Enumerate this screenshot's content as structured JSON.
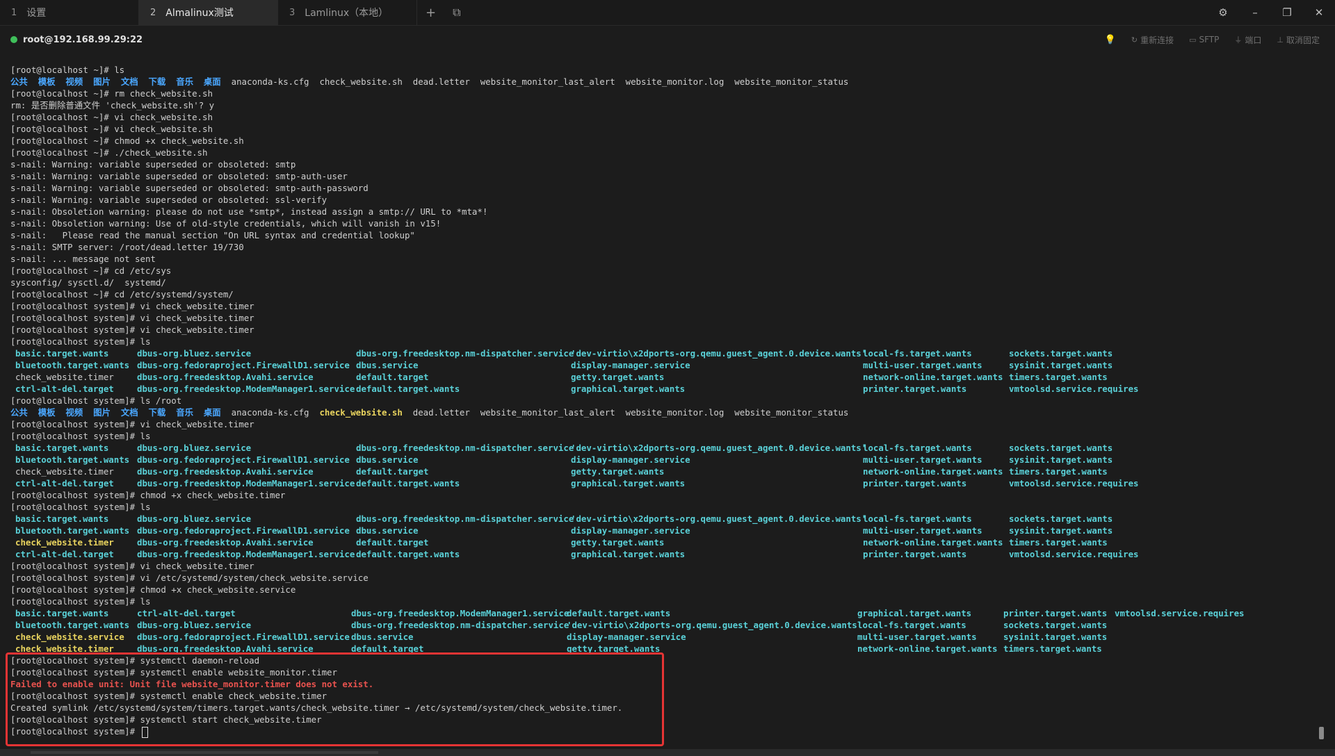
{
  "tabs": [
    {
      "num": "1",
      "label": "设置"
    },
    {
      "num": "2",
      "label": "Almalinux测试"
    },
    {
      "num": "3",
      "label": "Lamlinux（本地）"
    }
  ],
  "tab_controls": {
    "add": "+",
    "layout": "⧉"
  },
  "window_controls": {
    "settings": "⚙",
    "minimize": "–",
    "restore": "❐",
    "close": "✕"
  },
  "session": {
    "status_color": "#3fbf5a",
    "host": "root@192.168.99.29:22",
    "tools": {
      "bulb": "💡",
      "reconnect": "重新连接",
      "sftp": "SFTP",
      "port": "端口",
      "unpin": "取消固定"
    }
  },
  "colors": {
    "directory": "#4aa7ff",
    "link": "#5ad1d8",
    "executable": "#e8d35e",
    "error": "#e8524e",
    "highlight": "#e53434"
  },
  "terminal": {
    "b0": "[root@localhost ~]# ls",
    "ls_root": {
      "dirs": [
        "公共",
        "模板",
        "视频",
        "图片",
        "文档",
        "下载",
        "音乐",
        "桌面"
      ],
      "files": [
        "anaconda-ks.cfg",
        "check_website.sh",
        "dead.letter",
        "website_monitor_last_alert",
        "website_monitor.log",
        "website_monitor_status"
      ]
    },
    "b1": [
      "[root@localhost ~]# rm check_website.sh",
      "rm: 是否删除普通文件 'check_website.sh'? y",
      "[root@localhost ~]# vi check_website.sh",
      "[root@localhost ~]# vi check_website.sh",
      "[root@localhost ~]# chmod +x check_website.sh",
      "[root@localhost ~]# ./check_website.sh",
      "s-nail: Warning: variable superseded or obsoleted: smtp",
      "s-nail: Warning: variable superseded or obsoleted: smtp-auth-user",
      "s-nail: Warning: variable superseded or obsoleted: smtp-auth-password",
      "s-nail: Warning: variable superseded or obsoleted: ssl-verify",
      "s-nail: Obsoletion warning: please do not use *smtp*, instead assign a smtp:// URL to *mta*!",
      "s-nail: Obsoletion warning: Use of old-style credentials, which will vanish in v15!",
      "s-nail:   Please read the manual section \"On URL syntax and credential lookup\"",
      "s-nail: SMTP server: /root/dead.letter 19/730",
      "s-nail: ... message not sent",
      "[root@localhost ~]# cd /etc/sys",
      "sysconfig/ sysctl.d/  systemd/",
      "[root@localhost ~]# cd /etc/systemd/system/",
      "[root@localhost system]# vi check_website.timer",
      "[root@localhost system]# vi check_website.timer",
      "[root@localhost system]# vi check_website.timer",
      "[root@localhost system]# ls"
    ],
    "ls_sys_a": [
      [
        "basic.target.wants",
        "dbus-org.bluez.service",
        "dbus-org.freedesktop.nm-dispatcher.service",
        "'dev-virtio\\x2dports-org.qemu.guest_agent.0.device.wants'",
        "local-fs.target.wants",
        "sockets.target.wants"
      ],
      [
        "bluetooth.target.wants",
        "dbus-org.fedoraproject.FirewallD1.service",
        "dbus.service",
        "display-manager.service",
        "multi-user.target.wants",
        "sysinit.target.wants"
      ],
      [
        "check_website.timer",
        "dbus-org.freedesktop.Avahi.service",
        "default.target",
        "getty.target.wants",
        "network-online.target.wants",
        "timers.target.wants"
      ],
      [
        "ctrl-alt-del.target",
        "dbus-org.freedesktop.ModemManager1.service",
        "default.target.wants",
        "graphical.target.wants",
        "printer.target.wants",
        "vmtoolsd.service.requires"
      ]
    ],
    "b2": "[root@localhost system]# ls /root",
    "b3": [
      "[root@localhost system]# vi check_website.timer",
      "[root@localhost system]# ls"
    ],
    "b4": [
      "[root@localhost system]# chmod +x check_website.timer",
      "[root@localhost system]# ls"
    ],
    "b5": [
      "[root@localhost system]# vi check_website.timer",
      "[root@localhost system]# vi /etc/systemd/system/check_website.service",
      "[root@localhost system]# chmod +x check_website.service",
      "[root@localhost system]# ls"
    ],
    "ls_sys_b": [
      [
        "basic.target.wants",
        "ctrl-alt-del.target",
        "dbus-org.freedesktop.ModemManager1.service",
        "default.target.wants",
        "graphical.target.wants",
        "printer.target.wants",
        "vmtoolsd.service.requires"
      ],
      [
        "bluetooth.target.wants",
        "dbus-org.bluez.service",
        "dbus-org.freedesktop.nm-dispatcher.service",
        "'dev-virtio\\x2dports-org.qemu.guest_agent.0.device.wants'",
        "local-fs.target.wants",
        "sockets.target.wants",
        ""
      ],
      [
        "check_website.service",
        "dbus-org.fedoraproject.FirewallD1.service",
        "dbus.service",
        "display-manager.service",
        "multi-user.target.wants",
        "sysinit.target.wants",
        ""
      ],
      [
        "check_website.timer",
        "dbus-org.freedesktop.Avahi.service",
        "default.target",
        "getty.target.wants",
        "network-online.target.wants",
        "timers.target.wants",
        ""
      ]
    ],
    "b6": [
      "[root@localhost system]# systemctl daemon-reload",
      "[root@localhost system]# systemctl enable website_monitor.timer"
    ],
    "err": "Failed to enable unit: Unit file website_monitor.timer does not exist.",
    "b7": [
      "[root@localhost system]# systemctl enable check_website.timer",
      "Created symlink /etc/systemd/system/timers.target.wants/check_website.timer → /etc/systemd/system/check_website.timer.",
      "[root@localhost system]# systemctl start check_website.timer"
    ],
    "last_prompt": "[root@localhost system]# "
  }
}
